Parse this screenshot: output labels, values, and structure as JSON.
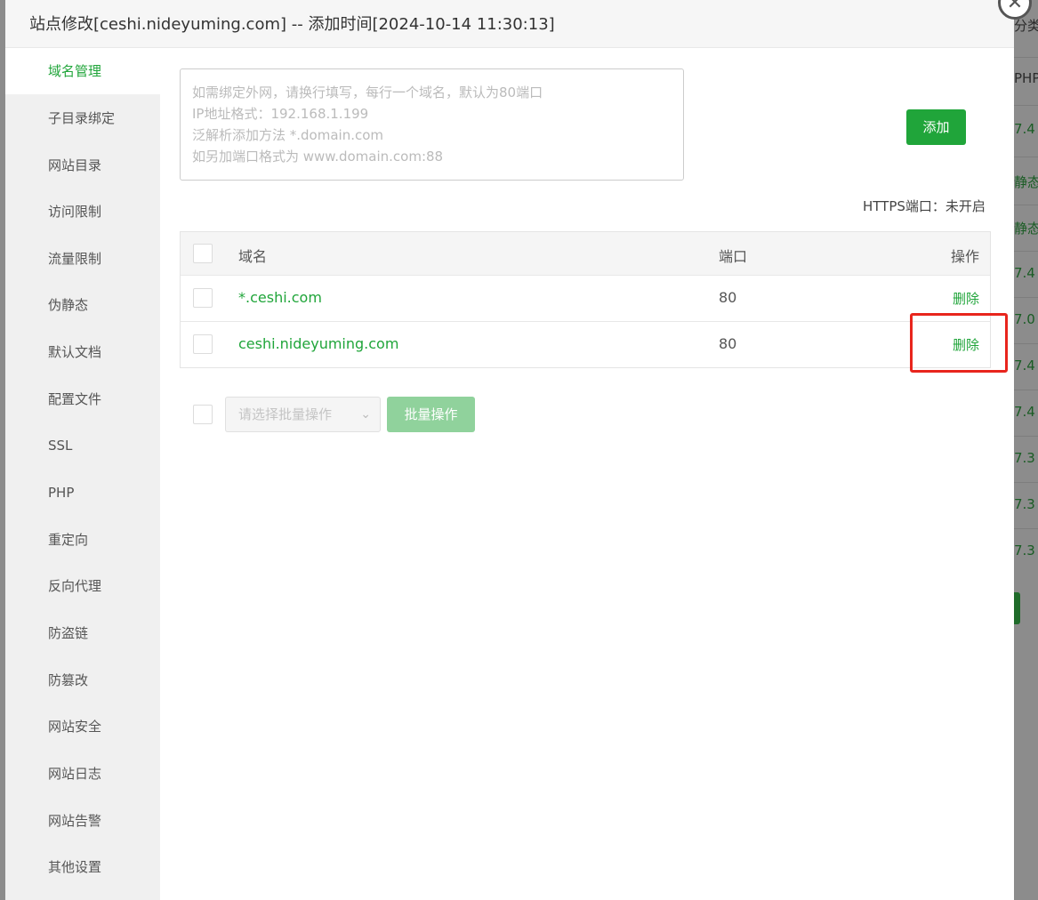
{
  "modal": {
    "title": "站点修改[ceshi.nideyuming.com] -- 添加时间[2024-10-14 11:30:13]",
    "close_icon": "close-icon"
  },
  "sidebar": {
    "items": [
      {
        "label": "域名管理",
        "active": true
      },
      {
        "label": "子目录绑定"
      },
      {
        "label": "网站目录"
      },
      {
        "label": "访问限制"
      },
      {
        "label": "流量限制"
      },
      {
        "label": "伪静态"
      },
      {
        "label": "默认文档"
      },
      {
        "label": "配置文件"
      },
      {
        "label": "SSL"
      },
      {
        "label": "PHP"
      },
      {
        "label": "重定向"
      },
      {
        "label": "反向代理"
      },
      {
        "label": "防盗链"
      },
      {
        "label": "防篡改"
      },
      {
        "label": "网站安全"
      },
      {
        "label": "网站日志"
      },
      {
        "label": "网站告警"
      },
      {
        "label": "其他设置"
      }
    ]
  },
  "domain_input": {
    "placeholder_lines": [
      "如需绑定外网，请换行填写，每行一个域名，默认为80端口",
      "IP地址格式：192.168.1.199",
      "泛解析添加方法 *.domain.com",
      "如另加端口格式为 www.domain.com:88"
    ],
    "value": ""
  },
  "add_button": "添加",
  "https_status": "HTTPS端口：未开启",
  "table": {
    "headers": {
      "domain": "域名",
      "port": "端口",
      "action": "操作"
    },
    "rows": [
      {
        "domain": "*.ceshi.com",
        "port": "80",
        "action": "删除"
      },
      {
        "domain": "ceshi.nideyuming.com",
        "port": "80",
        "action": "删除"
      }
    ]
  },
  "batch": {
    "select_placeholder": "请选择批量操作",
    "button": "批量操作"
  },
  "background": {
    "cells": [
      "分类",
      "PHP",
      "7.4",
      "静态",
      "静态",
      "7.4",
      "7.0",
      "7.4",
      "7.4",
      "7.3",
      "7.3",
      "7.3"
    ]
  },
  "colors": {
    "accent": "#20a53a",
    "highlight": "#e8251d"
  }
}
